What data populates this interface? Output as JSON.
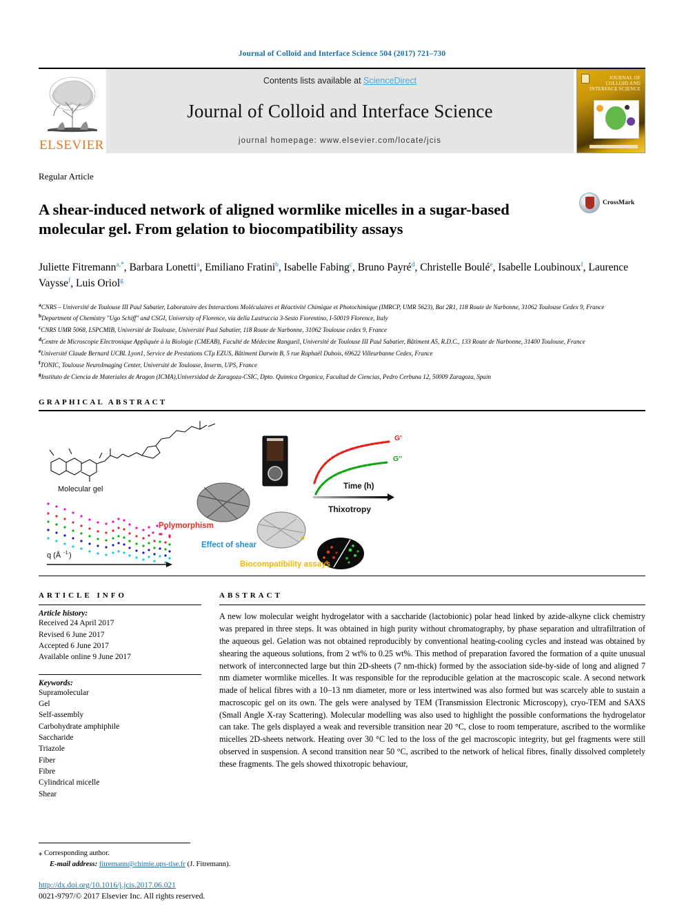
{
  "running_head": "Journal of Colloid and Interface Science 504 (2017) 721–730",
  "masthead": {
    "contents_prefix": "Contents lists available at ",
    "sciencedirect": "ScienceDirect",
    "journal_name": "Journal of Colloid and Interface Science",
    "homepage": "journal homepage: www.elsevier.com/locate/jcis",
    "publisher": "ELSEVIER",
    "cover_title": "COLLOID AND INTERFACE SCIENCE",
    "cover_kicker": "JOURNAL OF",
    "elsevier_orange": "#e87722",
    "sciencedirect_blue": "#4fa8d8"
  },
  "article": {
    "type": "Regular Article",
    "title": "A shear-induced network of aligned wormlike micelles in a sugar-based molecular gel. From gelation to biocompatibility assays",
    "crossmark_label": "CrossMark",
    "authors": [
      {
        "name": "Juliette Fitremann",
        "sup": "a,*"
      },
      {
        "name": "Barbara Lonetti",
        "sup": "a"
      },
      {
        "name": "Emiliano Fratini",
        "sup": "b"
      },
      {
        "name": "Isabelle Fabing",
        "sup": "c"
      },
      {
        "name": "Bruno Payré",
        "sup": "d"
      },
      {
        "name": "Christelle Boulé",
        "sup": "e"
      },
      {
        "name": "Isabelle Loubinoux",
        "sup": "f"
      },
      {
        "name": "Laurence Vaysse",
        "sup": "f"
      },
      {
        "name": "Luis Oriol",
        "sup": "g"
      }
    ],
    "affiliations": [
      {
        "sup": "a",
        "text": "CNRS – Université de Toulouse III Paul Sabatier, Laboratoire des Interactions Moléculaires et Réactivité Chimique et Photochimique (IMRCP, UMR 5623), Bat 2R1, 118 Route de Narbonne, 31062 Toulouse Cedex 9, France"
      },
      {
        "sup": "b",
        "text": "Department of Chemistry \"Ugo Schiff\" and CSGI, University of Florence, via della Lastruccia 3-Sesto Fiorentino, I-50019 Florence, Italy"
      },
      {
        "sup": "c",
        "text": "CNRS UMR 5068, LSPCMIB, Université de Toulouse, Université Paul Sabatier, 118 Route de Narbonne, 31062 Toulouse cedex 9, France"
      },
      {
        "sup": "d",
        "text": "Centre de Microscopie Electronique Appliquée à la Biologie (CMEAB), Faculté de Médecine Rangueil, Université de Toulouse III Paul Sabatier, Bâtiment A5, R.D.C., 133 Route de Narbonne, 31400 Toulouse, France"
      },
      {
        "sup": "e",
        "text": "Université Claude Bernard UCBL Lyon1, Service de Prestations CTμ EZUS, Bâtiment Darwin B, 5 rue Raphaël Dubois, 69622 Villeurbanne Cedex, France"
      },
      {
        "sup": "f",
        "text": "TONIC, Toulouse NeuroImaging Center, Université de Toulouse, Inserm, UPS, France"
      },
      {
        "sup": "g",
        "text": "Instituto de Ciencia de Materiales de Aragon (ICMA),Universidad de Zaragoza-CSIC, Dpto. Química Organica, Facultad de Ciencias, Pedro Cerbuna 12, 50009 Zaragoza, Spain"
      }
    ]
  },
  "graphical_abstract": {
    "heading": "GRAPHICAL ABSTRACT",
    "labels": {
      "molecular_gel": "Molecular gel",
      "q_axis": "q (Å⁻¹)",
      "polymorphism": "Polymorphism",
      "effect_of_shear": "Effect of shear",
      "biocompatibility": "Biocompatibility assays",
      "time_axis": "Time (h)",
      "thixotropy": "Thixotropy",
      "g_prime": "G'",
      "g_double_prime": "G''"
    },
    "colors": {
      "polymorphism": "#ee2b24",
      "effect_of_shear": "#1f8fd6",
      "biocompatibility": "#f5b700",
      "g_prime": "#e8201a",
      "g_double_prime": "#13a515",
      "saxs_curves": [
        "#ff00d0",
        "#ee1c1c",
        "#00b300",
        "#1414d2",
        "#12c8e8"
      ]
    }
  },
  "article_info": {
    "heading": "ARTICLE INFO",
    "history_title": "Article history:",
    "history": [
      "Received 24 April 2017",
      "Revised 6 June 2017",
      "Accepted 6 June 2017",
      "Available online 9 June 2017"
    ],
    "keywords_title": "Keywords:",
    "keywords": [
      "Supramolecular",
      "Gel",
      "Self-assembly",
      "Carbohydrate amphiphile",
      "Saccharide",
      "Triazole",
      "Fiber",
      "Fibre",
      "Cylindrical micelle",
      "Shear"
    ]
  },
  "abstract": {
    "heading": "ABSTRACT",
    "text": "A new low molecular weight hydrogelator with a saccharide (lactobionic) polar head linked by azide-alkyne click chemistry was prepared in three steps. It was obtained in high purity without chromatography, by phase separation and ultrafiltration of the aqueous gel. Gelation was not obtained reproducibly by conventional heating-cooling cycles and instead was obtained by shearing the aqueous solutions, from 2 wt% to 0.25 wt%. This method of preparation favored the formation of a quite unusual network of interconnected large but thin 2D-sheets (7 nm-thick) formed by the association side-by-side of long and aligned 7 nm diameter wormlike micelles. It was responsible for the reproducible gelation at the macroscopic scale. A second network made of helical fibres with a 10–13 nm diameter, more or less intertwined was also formed but was scarcely able to sustain a macroscopic gel on its own. The gels were analysed by TEM (Transmission Electronic Microscopy), cryo-TEM and SAXS (Small Angle X-ray Scattering). Molecular modelling was also used to highlight the possible conformations the hydrogelator can take. The gels displayed a weak and reversible transition near 20 °C, close to room temperature, ascribed to the wormlike micelles 2D-sheets network. Heating over 30 °C led to the loss of the gel macroscopic integrity, but gel fragments were still observed in suspension. A second transition near 50 °C, ascribed to the network of helical fibres, finally dissolved completely these fragments. The gels showed thixotropic behaviour,"
  },
  "footer": {
    "corresponding_marker": "⁎",
    "corresponding_label": "Corresponding author.",
    "email_label": "E-mail address:",
    "email": "fitremann@chimie.ups-tlse.fr",
    "email_owner": "(J. Fitremann).",
    "doi": "http://dx.doi.org/10.1016/j.jcis.2017.06.021",
    "copyright": "0021-9797/© 2017 Elsevier Inc. All rights reserved."
  }
}
